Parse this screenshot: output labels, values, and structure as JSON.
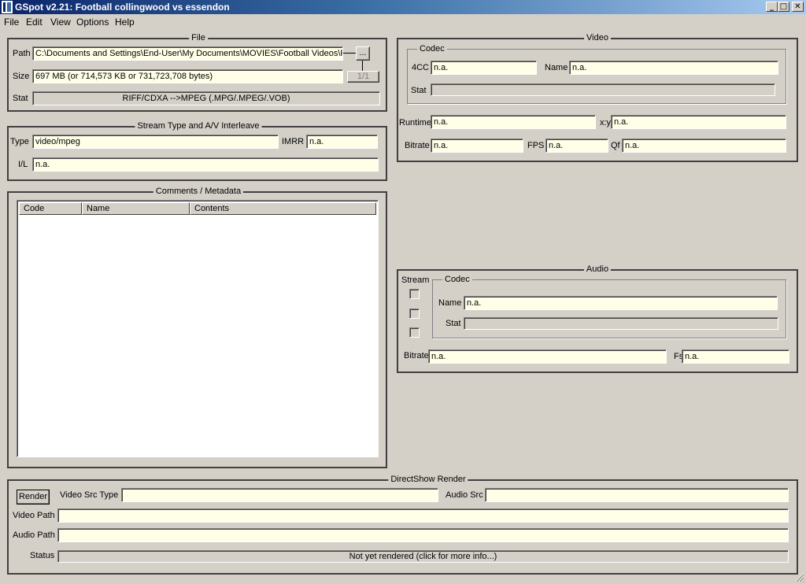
{
  "window": {
    "title": "GSpot v2.21: Football collingwood vs essendon"
  },
  "caption_buttons": {
    "minimize": "_",
    "maximize": "□",
    "close": "✕"
  },
  "menu": [
    "File",
    "Edit",
    "View",
    "Options",
    "Help"
  ],
  "file": {
    "title": "File",
    "path_label": "Path",
    "path_value": "C:\\Documents and Settings\\End-User\\My Documents\\MOVIES\\Football Videos\\F",
    "browse_label": "...",
    "size_label": "Size",
    "size_value": "697 MB (or 714,573 KB or 731,723,708 bytes)",
    "counter": "1/1",
    "stat_label": "Stat",
    "stat_value": "RIFF/CDXA -->MPEG (.MPG/.MPEG/.VOB)"
  },
  "stream": {
    "title": "Stream Type and A/V Interleave",
    "type_label": "Type",
    "type_value": "video/mpeg",
    "imrr_label": "IMRR",
    "imrr_value": "n.a.",
    "il_label": "I/L",
    "il_value": "n.a."
  },
  "comments": {
    "title": "Comments / Metadata",
    "columns": [
      "Code",
      "Name",
      "Contents"
    ]
  },
  "video": {
    "title": "Video",
    "codec_title": "Codec",
    "fourcc_label": "4CC",
    "fourcc_value": "n.a.",
    "name_label": "Name",
    "name_value": "n.a.",
    "stat_label": "Stat",
    "stat_value": "",
    "runtime_label": "Runtime",
    "runtime_value": "n.a.",
    "xy_label": "x:y",
    "xy_value": "n.a.",
    "bitrate_label": "Bitrate",
    "bitrate_value": "n.a.",
    "fps_label": "FPS",
    "fps_value": "n.a.",
    "qf_label": "Qf",
    "qf_value": "n.a."
  },
  "audio": {
    "title": "Audio",
    "stream_label": "Stream",
    "codec_title": "Codec",
    "name_label": "Name",
    "name_value": "n.a.",
    "stat_label": "Stat",
    "stat_value": "",
    "bitrate_label": "Bitrate",
    "bitrate_value": "n.a.",
    "fs_label": "Fs",
    "fs_value": "n.a."
  },
  "directshow": {
    "title": "DirectShow Render",
    "render_label": "Render",
    "video_src_type_label": "Video Src Type",
    "video_src_type_value": "",
    "audio_src_label": "Audio Src",
    "audio_src_value": "",
    "video_path_label": "Video Path",
    "video_path_value": "",
    "audio_path_label": "Audio Path",
    "audio_path_value": "",
    "status_label": "Status",
    "status_value": "Not yet rendered (click for more info...)"
  },
  "colors": {
    "face": "#d4d0c8",
    "field": "#ffffe8",
    "title_start": "#0a246a",
    "title_end": "#a6caf0"
  }
}
